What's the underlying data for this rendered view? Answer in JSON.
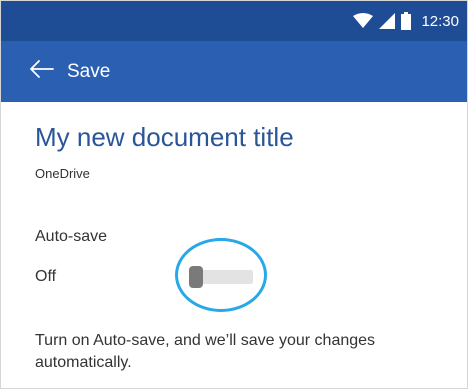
{
  "status_bar": {
    "time": "12:30",
    "icons": [
      "wifi-icon",
      "signal-icon",
      "battery-icon"
    ],
    "background": "#1f4d95"
  },
  "app_bar": {
    "title": "Save",
    "back_icon": "back-arrow-icon",
    "background": "#2b5fb2"
  },
  "document": {
    "title": "My new document title",
    "location": "OneDrive"
  },
  "autosave": {
    "label": "Auto-save",
    "state_text": "Off",
    "enabled": false,
    "description": "Turn on Auto-save, and we’ll save your changes automatically."
  },
  "colors": {
    "accent": "#2a5599",
    "highlight": "#27a8e8"
  }
}
